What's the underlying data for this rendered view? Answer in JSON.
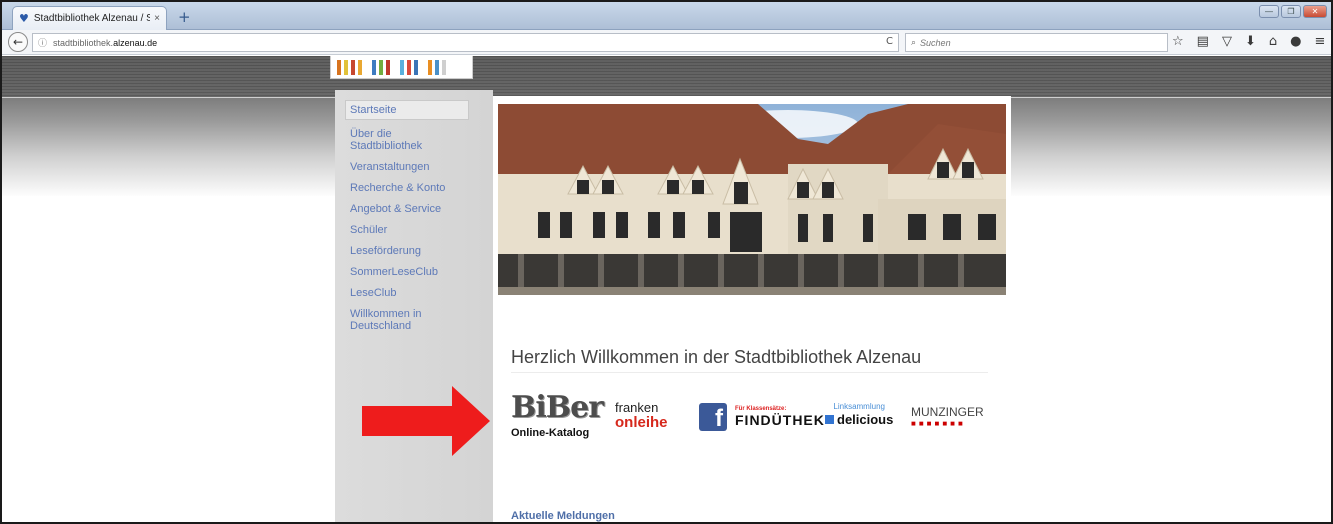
{
  "browser": {
    "tab_title": "Stadtbibliothek Alzenau / S...",
    "tab_close": "×",
    "new_tab": "+",
    "url_host_prefix": "stadtbibliothek.",
    "url_host_main": "alzenau.de",
    "search_placeholder": "Suchen"
  },
  "sidebar": {
    "items": [
      {
        "label": "Startseite"
      },
      {
        "label": "Über die Stadtbibliothek"
      },
      {
        "label": "Veranstaltungen"
      },
      {
        "label": "Recherche & Konto"
      },
      {
        "label": "Angebot & Service"
      },
      {
        "label": "Schüler"
      },
      {
        "label": "Leseförderung"
      },
      {
        "label": "SommerLeseClub"
      },
      {
        "label": "LeseClub"
      },
      {
        "label": "Willkommen in Deutschland"
      }
    ]
  },
  "main": {
    "welcome": "Herzlich Willkommen in der Stadtbibliothek Alzenau",
    "logos": {
      "biber_word": "BiBer",
      "biber_caption": "Online-Katalog",
      "onleihe_top": "franken",
      "onleihe_bottom": "onleihe",
      "facebook": "f",
      "finduthek_small": "Für Klassensätze:",
      "finduthek_big": "FINDÜTHEK",
      "delicious_small": "Linksammlung",
      "delicious_big": "delicious",
      "munzinger": "MUNZINGER"
    },
    "news_heading": "Aktuelle Meldungen"
  },
  "colors": {
    "link": "#5d79b8",
    "arrow": "#ee1c1c",
    "sidebar_bg": "#d6d6d6"
  }
}
